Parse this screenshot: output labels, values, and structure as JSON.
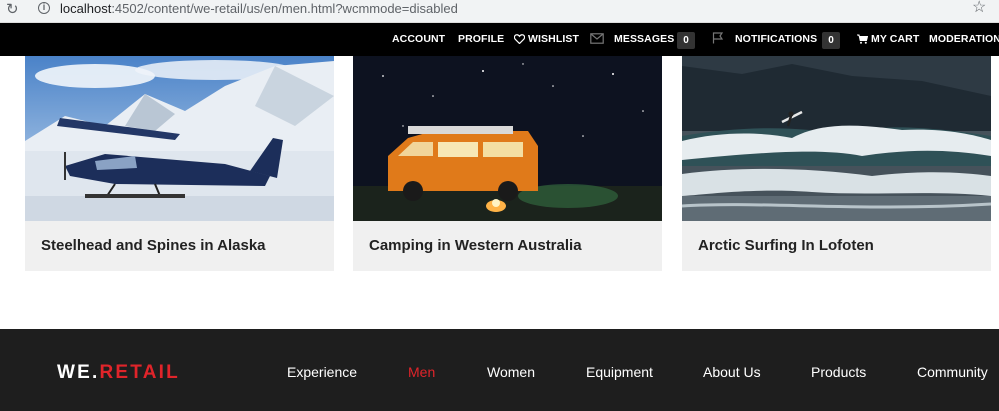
{
  "browser": {
    "url_host": "localhost",
    "url_path": ":4502/content/we-retail/us/en/men.html?wcmmode=disabled",
    "reload_icon": "reload-icon",
    "bookmark_icon": "star-icon"
  },
  "topnav": {
    "account": "ACCOUNT",
    "profile": "PROFILE",
    "wishlist": "WISHLIST",
    "messages": "MESSAGES",
    "messages_count": "0",
    "notifications": "NOTIFICATIONS",
    "notifications_count": "0",
    "cart": "MY CART",
    "moderation": "MODERATION"
  },
  "cards": [
    {
      "title": "Steelhead and Spines in Alaska",
      "image": "seaplane-on-snow"
    },
    {
      "title": "Camping in Western Australia",
      "image": "campervan-at-night"
    },
    {
      "title": "Arctic Surfing In Lofoten",
      "image": "surfer-on-wave"
    }
  ],
  "footer": {
    "logo_we": "WE",
    "logo_dot": ".",
    "logo_retail": "RETAIL",
    "nav": [
      "Experience",
      "Men",
      "Women",
      "Equipment",
      "About Us",
      "Products",
      "Community"
    ],
    "active_nav": "Men"
  },
  "colors": {
    "brand_red": "#e0242a",
    "nav_bg": "#000000",
    "footer_bg": "#1e1e1e",
    "card_bg": "#f0f0f0"
  }
}
